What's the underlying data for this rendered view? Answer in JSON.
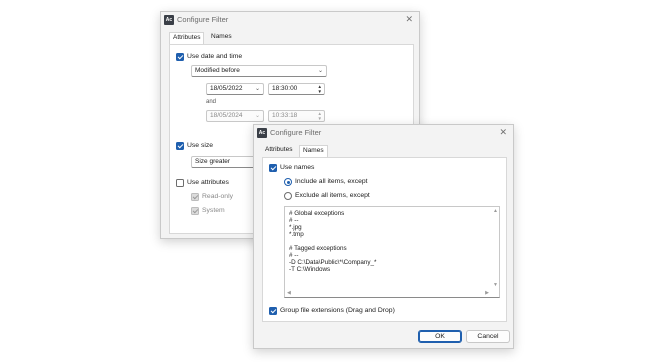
{
  "back_dialog": {
    "app_icon": "Ac",
    "title": "Configure Filter",
    "close_icon": "close-icon",
    "tabs": [
      "Attributes",
      "Names"
    ],
    "use_date_label": "Use date and time",
    "date_mode_value": "Modified before",
    "date1": "18/05/2022",
    "time1": "18:30:00",
    "and_label": "and",
    "date2": "18/05/2024",
    "time2": "10:33:18",
    "use_size_label": "Use size",
    "size_mode_value": "Size greater",
    "use_attributes_label": "Use attributes",
    "readonly_label": "Read-only",
    "system_label": "System"
  },
  "front_dialog": {
    "app_icon": "Ac",
    "title": "Configure Filter",
    "tabs": [
      "Attributes",
      "Names"
    ],
    "use_names_label": "Use names",
    "include_label": "Include all items, except",
    "exclude_label": "Exclude all items, except",
    "exceptions_lines": [
      "# Global exceptions",
      "# --",
      "*.jpg",
      "*.tmp",
      "",
      "# Tagged exceptions",
      "# --",
      "-D C:\\Data\\Public\\*\\Company_*",
      "-T C:\\Windows"
    ],
    "group_ext_label": "Group file extensions (Drag and Drop)",
    "ok_label": "OK",
    "cancel_label": "Cancel"
  },
  "colors": {
    "accent": "#1f5fae",
    "dialog_bg": "#f3f3f3",
    "panel_bg": "#ffffff"
  }
}
